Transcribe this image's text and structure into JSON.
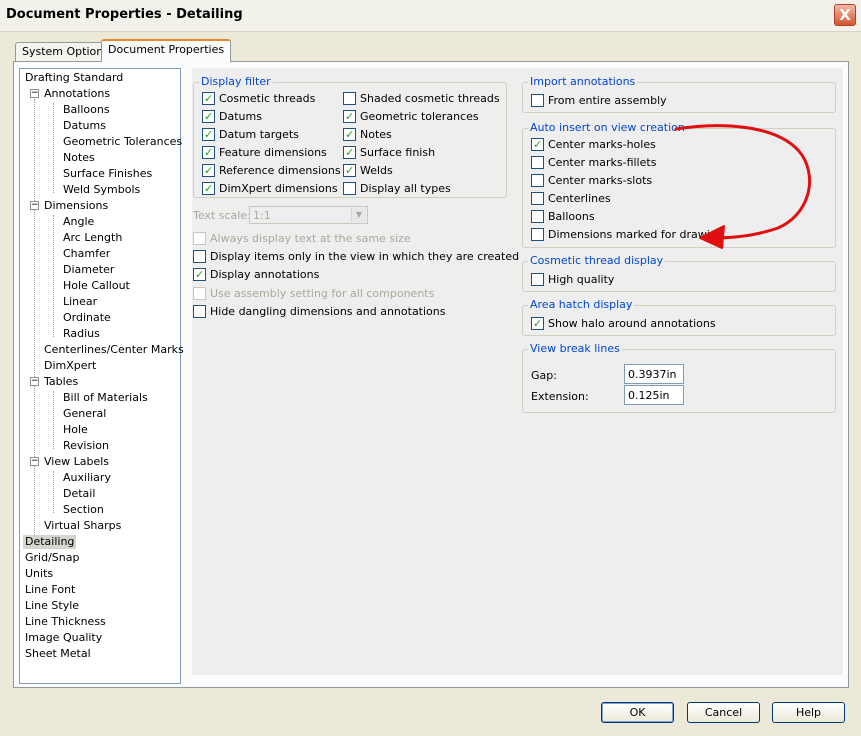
{
  "window": {
    "title": "Document Properties - Detailing",
    "close_label": "X"
  },
  "tabs": [
    {
      "label": "System Options"
    },
    {
      "label": "Document Properties"
    }
  ],
  "tree": {
    "items": [
      {
        "label": "Drafting Standard"
      },
      {
        "label": "Annotations"
      },
      {
        "label": "Balloons"
      },
      {
        "label": "Datums"
      },
      {
        "label": "Geometric Tolerances"
      },
      {
        "label": "Notes"
      },
      {
        "label": "Surface Finishes"
      },
      {
        "label": "Weld Symbols"
      },
      {
        "label": "Dimensions"
      },
      {
        "label": "Angle"
      },
      {
        "label": "Arc Length"
      },
      {
        "label": "Chamfer"
      },
      {
        "label": "Diameter"
      },
      {
        "label": "Hole Callout"
      },
      {
        "label": "Linear"
      },
      {
        "label": "Ordinate"
      },
      {
        "label": "Radius"
      },
      {
        "label": "Centerlines/Center Marks"
      },
      {
        "label": "DimXpert"
      },
      {
        "label": "Tables"
      },
      {
        "label": "Bill of Materials"
      },
      {
        "label": "General"
      },
      {
        "label": "Hole"
      },
      {
        "label": "Revision"
      },
      {
        "label": "View Labels"
      },
      {
        "label": "Auxiliary"
      },
      {
        "label": "Detail"
      },
      {
        "label": "Section"
      },
      {
        "label": "Virtual Sharps"
      },
      {
        "label": "Detailing"
      },
      {
        "label": "Grid/Snap"
      },
      {
        "label": "Units"
      },
      {
        "label": "Line Font"
      },
      {
        "label": "Line Style"
      },
      {
        "label": "Line Thickness"
      },
      {
        "label": "Image Quality"
      },
      {
        "label": "Sheet Metal"
      }
    ],
    "expander_symbol": "−"
  },
  "display_filter": {
    "title": "Display filter",
    "items": [
      {
        "label": "Cosmetic threads",
        "checked": true
      },
      {
        "label": "Shaded cosmetic threads",
        "checked": false
      },
      {
        "label": "Datums",
        "checked": true
      },
      {
        "label": "Geometric tolerances",
        "checked": true
      },
      {
        "label": "Datum targets",
        "checked": true
      },
      {
        "label": "Notes",
        "checked": true
      },
      {
        "label": "Feature dimensions",
        "checked": true
      },
      {
        "label": "Surface finish",
        "checked": true
      },
      {
        "label": "Reference dimensions",
        "checked": true
      },
      {
        "label": "Welds",
        "checked": true
      },
      {
        "label": "DimXpert dimensions",
        "checked": true
      },
      {
        "label": "Display all types",
        "checked": false
      }
    ]
  },
  "text_scale": {
    "label": "Text scale:",
    "value": "1:1"
  },
  "options": [
    {
      "label": "Always display text at the same size",
      "checked": false,
      "disabled": true
    },
    {
      "label": "Display items only in the view in which they are created",
      "checked": false,
      "disabled": false
    },
    {
      "label": "Display annotations",
      "checked": true,
      "disabled": false
    },
    {
      "label": "Use assembly setting for all components",
      "checked": false,
      "disabled": true
    },
    {
      "label": "Hide dangling dimensions and annotations",
      "checked": false,
      "disabled": false
    }
  ],
  "import_annotations": {
    "title": "Import annotations",
    "items": [
      {
        "label": "From entire assembly",
        "checked": false
      }
    ]
  },
  "auto_insert": {
    "title": "Auto insert on view creation",
    "items": [
      {
        "label": "Center marks-holes",
        "checked": true
      },
      {
        "label": "Center marks-fillets",
        "checked": false
      },
      {
        "label": "Center marks-slots",
        "checked": false
      },
      {
        "label": "Centerlines",
        "checked": false
      },
      {
        "label": "Balloons",
        "checked": false
      },
      {
        "label": "Dimensions marked for drawing",
        "checked": false
      }
    ]
  },
  "cosmetic_thread": {
    "title": "Cosmetic thread display",
    "items": [
      {
        "label": "High quality",
        "checked": false
      }
    ]
  },
  "area_hatch": {
    "title": "Area hatch display",
    "items": [
      {
        "label": "Show halo around annotations",
        "checked": true
      }
    ]
  },
  "view_break": {
    "title": "View break lines",
    "gap_label": "Gap:",
    "gap_value": "0.3937in",
    "extension_label": "Extension:",
    "extension_value": "0.125in"
  },
  "buttons": {
    "ok": "OK",
    "cancel": "Cancel",
    "help": "Help"
  },
  "colors": {
    "annotation_arrow": "#e01010",
    "group_title": "#0046d5",
    "accent_tab": "#e68b2c"
  }
}
